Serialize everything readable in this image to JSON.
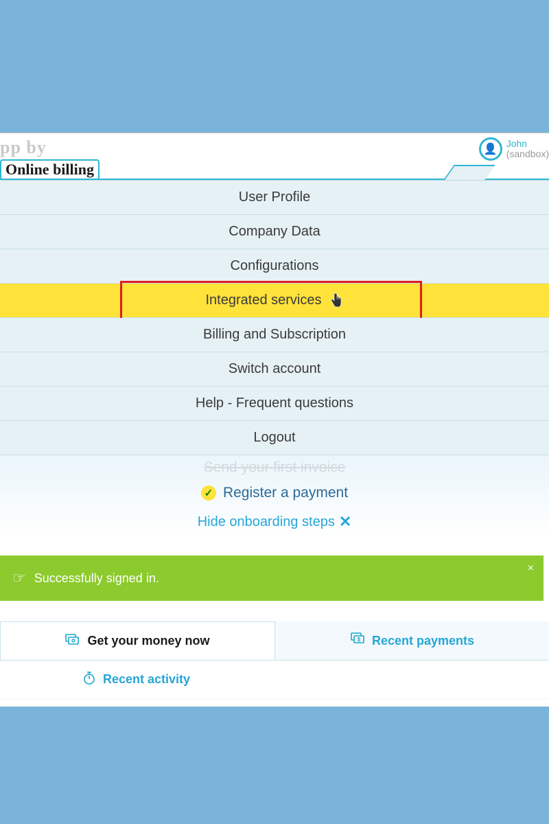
{
  "header": {
    "logo_line1": "pp by",
    "logo_line2": "Online billing",
    "user_name": "John",
    "user_env": "(sandbox)"
  },
  "menu": {
    "items": [
      {
        "label": "User Profile"
      },
      {
        "label": "Company Data"
      },
      {
        "label": "Configurations"
      },
      {
        "label": "Integrated services"
      },
      {
        "label": "Billing and Subscription"
      },
      {
        "label": "Switch account"
      },
      {
        "label": "Help - Frequent questions"
      },
      {
        "label": "Logout"
      }
    ]
  },
  "onboarding": {
    "peek_title": "Send your first invoice",
    "register_payment": "Register a payment",
    "hide_label": "Hide onboarding steps"
  },
  "alert": {
    "message": "Successfully signed in."
  },
  "tabs": {
    "money_now": "Get your money now",
    "recent_payments": "Recent payments",
    "recent_activity": "Recent activity"
  }
}
